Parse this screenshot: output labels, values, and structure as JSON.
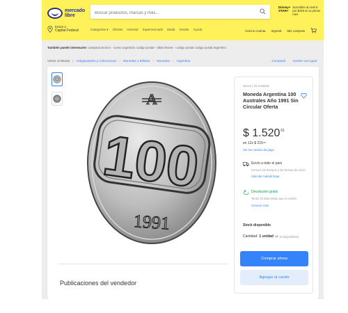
{
  "header": {
    "logo_text": "mercado\nlibre",
    "search_placeholder": "Buscar productos, marcas y más...",
    "promo_badge": "Disney+ STAR+",
    "promo_text": "Suscribite al nivel 6 por $449 en tu primer mes",
    "location_label": "Enviar a",
    "location_value": "Capital Federal",
    "nav_items": [
      "Categorías ▾",
      "Ofertas",
      "Historial",
      "Supermercado",
      "Moda",
      "Vender",
      "Ayuda"
    ],
    "account_links": [
      "Creá tu cuenta",
      "Ingresá",
      "Mis compras"
    ]
  },
  "related": {
    "label": "También puede interesarte:",
    "text": "campana bronce - cuneo argentino codigo postal - sillas thonet - codigo postal codigo postal argentino"
  },
  "breadcrumb": {
    "back": "Volver al listado",
    "items": [
      "Antigüedades y Colecciones",
      "Monedas y Billetes",
      "Monedas",
      "Argentina"
    ],
    "share": "Compartir",
    "sell_same": "Vender uno igual"
  },
  "coin": {
    "denomination": "100",
    "year": "1991"
  },
  "product": {
    "meta": "Nuevo  |  15 vendidos",
    "title": "Moneda Argentina 100 Australes Año 1991 Sin Circular Oferta",
    "price": "$ 1.520",
    "price_cents": "01",
    "installments": "en 12x $ 215",
    "installments_cents": "55",
    "payment_link": "Ver los medios de pago",
    "shipping_title": "Envío a todo el país",
    "shipping_sub": "Conocé los tiempos y las formas de envío.",
    "shipping_link": "Calcular cuándo llega",
    "returns_title": "Devolución gratis",
    "returns_sub": "Tenés 30 días desde que lo recibís.",
    "returns_link": "Conocer más",
    "stock": "Stock disponible",
    "qty_label": "Cantidad:",
    "qty_value": "1 unidad",
    "qty_avail": "(6 disponibles)",
    "buy_button": "Comprar ahora",
    "cart_button": "Agregar al carrito"
  },
  "seller_publications": "Publicaciones del vendedor",
  "colors": {
    "header_bg": "#fff159",
    "accent": "#3483fa",
    "green": "#00a650",
    "coin_metal": "#bdbdbd"
  }
}
